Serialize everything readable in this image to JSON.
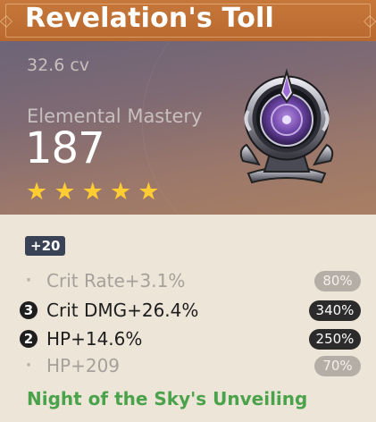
{
  "artifact": {
    "name": "Revelation's Toll",
    "cv": "32.6 cv",
    "main_stat": {
      "name": "Elemental Mastery",
      "value": "187"
    },
    "rarity": 5,
    "stars": [
      "★",
      "★",
      "★",
      "★",
      "★"
    ],
    "level": "+20",
    "substats": [
      {
        "text": "Crit Rate+3.1%",
        "marker": "·",
        "percent": "80%",
        "emphasis": false
      },
      {
        "text": "Crit DMG+26.4%",
        "marker": "3",
        "percent": "340%",
        "emphasis": true
      },
      {
        "text": "HP+14.6%",
        "marker": "2",
        "percent": "250%",
        "emphasis": true
      },
      {
        "text": "HP+209",
        "marker": "·",
        "percent": "70%",
        "emphasis": false
      }
    ],
    "set_name": "Night of the Sky's Unveiling",
    "icon": "artifact-goblet-icon"
  },
  "colors": {
    "title_bg": "#bd6f33",
    "star": "#ffcc32",
    "set_name": "#4aa34a",
    "level_badge": "#3a4355",
    "pill_dark": "#2b2b2b",
    "pill_dim": "#b5aea6",
    "body_bg": "#ece5d8"
  }
}
